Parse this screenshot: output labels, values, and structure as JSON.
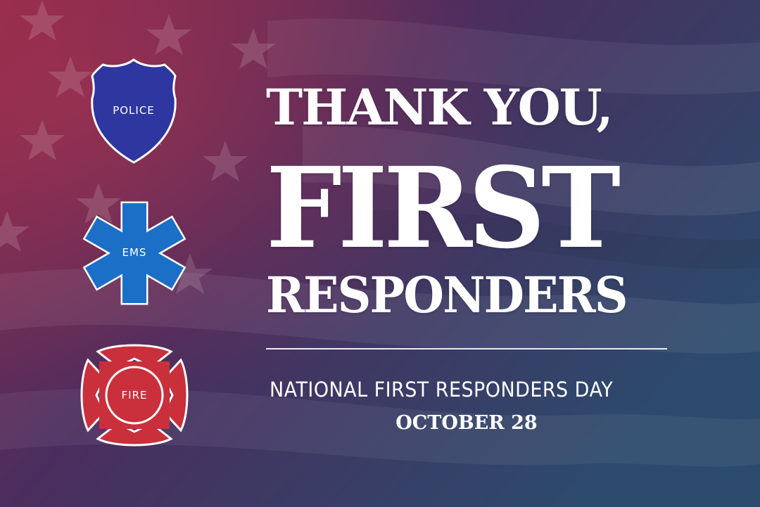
{
  "badges": {
    "police": {
      "label": "POLICE",
      "color": "#2e36a0",
      "icon": "police-shield-icon"
    },
    "ems": {
      "label": "EMS",
      "color": "#1b6fc6",
      "icon": "star-of-life-icon"
    },
    "fire": {
      "label": "FIRE",
      "color": "#c9303b",
      "icon": "maltese-cross-icon"
    }
  },
  "headline": {
    "line1": "THANK YOU,",
    "line2": "FIRST",
    "line3": "RESPONDERS"
  },
  "subtitle": "NATIONAL FIRST RESPONDERS DAY",
  "date": "OCTOBER 28",
  "colors": {
    "background_left": "#8c2a4e",
    "background_right": "#2f4a6e",
    "text": "#ffffff"
  }
}
